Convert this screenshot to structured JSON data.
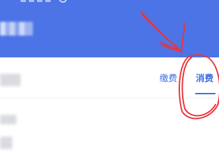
{
  "tabs": [
    {
      "label": "缴费",
      "active": false
    },
    {
      "label": "消费",
      "active": true
    }
  ],
  "colors": {
    "header": "#4c74e6",
    "accent": "#3f6fe0",
    "annotation": "#e8363b"
  },
  "icons": {
    "annotation_arrow": "arrow-annotation",
    "annotation_circle": "circle-annotation"
  }
}
